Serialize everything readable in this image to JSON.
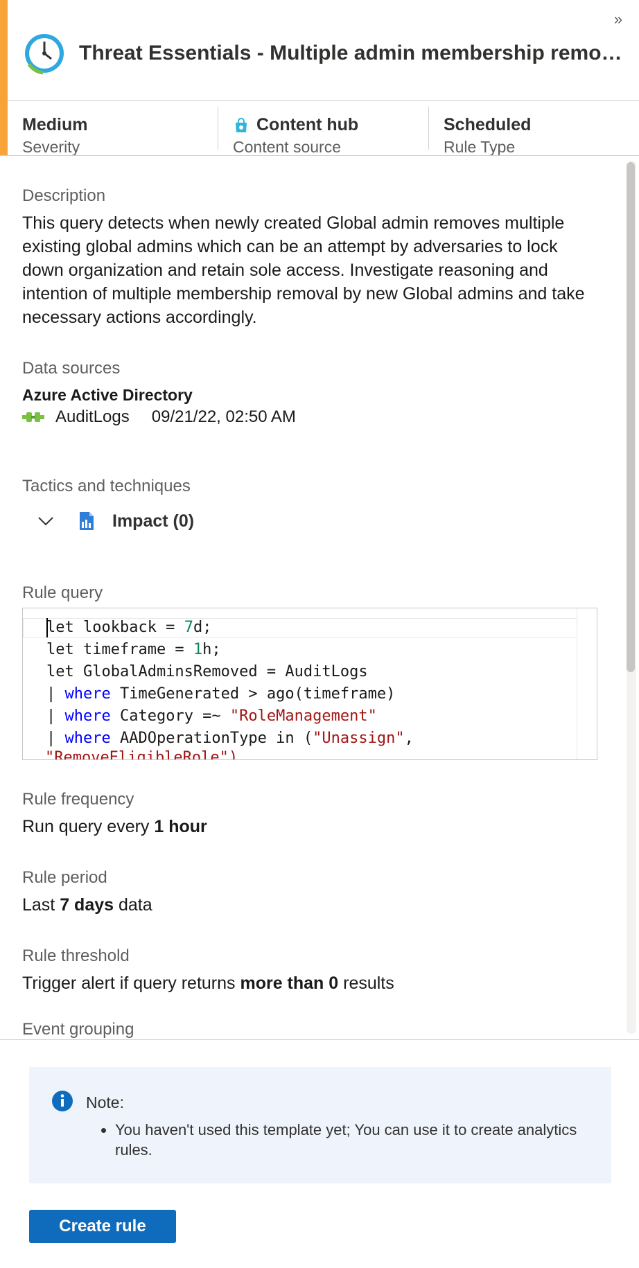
{
  "header": {
    "title": "Threat Essentials - Multiple admin membership removal from newly created admin."
  },
  "meta": [
    {
      "value": "Medium",
      "label": "Severity"
    },
    {
      "value": "Content hub",
      "label": "Content source",
      "icon": "shopping-bag-icon"
    },
    {
      "value": "Scheduled",
      "label": "Rule Type"
    }
  ],
  "description": {
    "label": "Description",
    "text": "This query detects when newly created Global admin removes multiple existing global admins which can be an attempt by adversaries to lock down organization and retain sole access. Investigate reasoning and intention of multiple membership removal by new Global admins and take necessary actions accordingly."
  },
  "data_sources": {
    "label": "Data sources",
    "connector": "Azure Active Directory",
    "table": "AuditLogs",
    "timestamp": "09/21/22, 02:50 AM"
  },
  "tactics": {
    "label": "Tactics and techniques",
    "item": "Impact (0)"
  },
  "rule_query": {
    "label": "Rule query",
    "lines": [
      "let lookback = 7d;",
      "let timeframe = 1h;",
      "let GlobalAdminsRemoved = AuditLogs",
      "| where TimeGenerated > ago(timeframe)",
      "| where Category =~ \"RoleManagement\"",
      "| where AADOperationType in (\"Unassign\",",
      "\"RemoveEligibleRole\")"
    ]
  },
  "rule_frequency": {
    "label": "Rule frequency",
    "prefix": "Run query every ",
    "value": "1 hour"
  },
  "rule_period": {
    "label": "Rule period",
    "prefix": "Last ",
    "value": "7 days",
    "suffix": " data"
  },
  "rule_threshold": {
    "label": "Rule threshold",
    "prefix": "Trigger alert if query returns ",
    "value": "more than 0",
    "suffix": " results"
  },
  "event_grouping": {
    "label": "Event grouping"
  },
  "note": {
    "title": "Note:",
    "items": [
      "You haven't used this template yet; You can use it to create analytics rules."
    ]
  },
  "actions": {
    "create_rule": "Create rule"
  },
  "colors": {
    "accent": "#f7a338",
    "primary_button": "#0f6cbd",
    "note_background": "#eff4fc"
  }
}
